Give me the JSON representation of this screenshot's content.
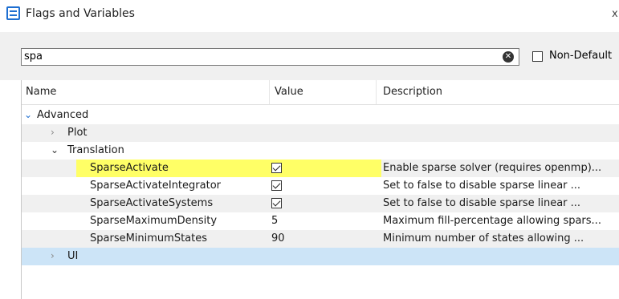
{
  "window": {
    "title": "Flags and Variables",
    "close_glyph": "x"
  },
  "search": {
    "value": "spa",
    "clear_icon": "clear-circle-icon",
    "non_default_label": "Non-Default"
  },
  "columns": {
    "name": "Name",
    "value": "Value",
    "description": "Description"
  },
  "tree": {
    "advanced": {
      "label": "Advanced",
      "expanded": true
    },
    "plot": {
      "label": "Plot",
      "expanded": false
    },
    "translation": {
      "label": "Translation",
      "expanded": true
    },
    "ui": {
      "label": "UI",
      "expanded": false,
      "selected": true
    }
  },
  "flags": [
    {
      "name": "SparseActivate",
      "value": true,
      "description": "Enable sparse solver (requires openmp)...",
      "highlighted": true
    },
    {
      "name": "SparseActivateIntegrator",
      "value": true,
      "description": "Set to false to disable sparse linear ..."
    },
    {
      "name": "SparseActivateSystems",
      "value": true,
      "description": "Set to false to disable sparse linear ..."
    },
    {
      "name": "SparseMaximumDensity",
      "value": "5",
      "description": "Maximum fill-percentage allowing spars..."
    },
    {
      "name": "SparseMinimumStates",
      "value": "90",
      "description": "Minimum number of states allowing ..."
    }
  ],
  "colors": {
    "accent": "#1e6fd1",
    "highlight": "#ffff66",
    "selected_row": "#cce4f7",
    "alt_row": "#f0f0f0"
  }
}
